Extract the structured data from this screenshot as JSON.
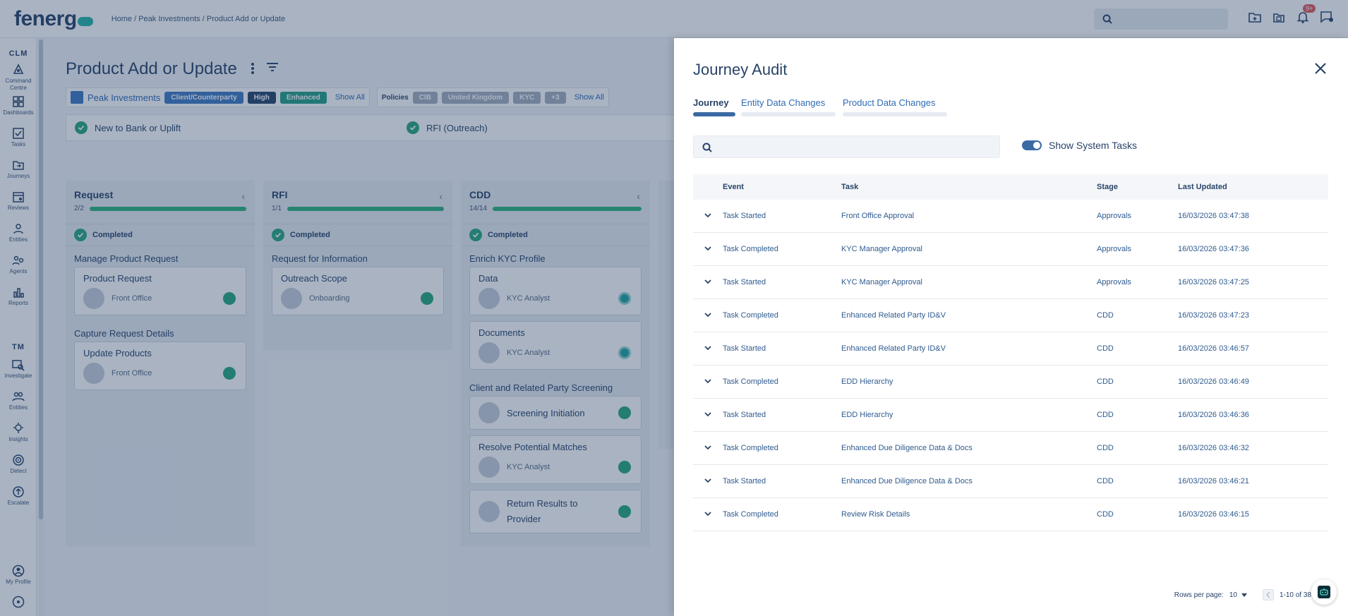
{
  "header": {
    "logo_text": "fenerg",
    "breadcrumb": "Home / Peak Investments / Product Add or Update",
    "notification_count": "9+"
  },
  "sidebar": {
    "section_clm": "CLM",
    "section_tm": "TM",
    "items_clm": [
      {
        "label": "Command Centre",
        "icon": "command-centre-icon"
      },
      {
        "label": "Dashboards",
        "icon": "dashboard-icon"
      },
      {
        "label": "Tasks",
        "icon": "tasks-icon"
      },
      {
        "label": "Journeys",
        "icon": "journeys-icon"
      },
      {
        "label": "Reviews",
        "icon": "reviews-icon"
      },
      {
        "label": "Entities",
        "icon": "entities-icon"
      },
      {
        "label": "Agents",
        "icon": "agents-icon"
      },
      {
        "label": "Reports",
        "icon": "reports-icon"
      }
    ],
    "items_tm": [
      {
        "label": "Investigate",
        "icon": "investigate-icon"
      },
      {
        "label": "Entities",
        "icon": "entities-icon"
      },
      {
        "label": "Insights",
        "icon": "insights-icon"
      },
      {
        "label": "Detect",
        "icon": "detect-icon"
      },
      {
        "label": "Escalate",
        "icon": "escalate-icon"
      }
    ],
    "profile_label": "My Profile"
  },
  "page": {
    "title": "Product Add or Update",
    "entity_name": "Peak Investments",
    "entity_chips": [
      "Client/Counterparty",
      "High",
      "Enhanced"
    ],
    "show_all": "Show All",
    "policies_label": "Policies",
    "policy_chips": [
      "CIB",
      "United Kingdom",
      "KYC",
      "+3"
    ],
    "stages": [
      "New to Bank or Uplift",
      "RFI (Outreach)"
    ]
  },
  "board": {
    "columns": [
      {
        "title": "Request",
        "progress_text": "2/2",
        "progress": 1.0,
        "completed_label": "Completed",
        "groups": [
          {
            "title": "Manage Product Request",
            "tasks": [
              {
                "name": "Product Request",
                "role": "Front Office"
              }
            ]
          },
          {
            "title": "Capture Request Details",
            "tasks": [
              {
                "name": "Update Products",
                "role": "Front Office"
              }
            ]
          }
        ]
      },
      {
        "title": "RFI",
        "progress_text": "1/1",
        "progress": 1.0,
        "completed_label": "Completed",
        "groups": [
          {
            "title": "Request for Information",
            "tasks": [
              {
                "name": "Outreach Scope",
                "role": "Onboarding"
              }
            ]
          }
        ]
      },
      {
        "title": "CDD",
        "progress_text": "14/14",
        "progress": 1.0,
        "completed_label": "Completed",
        "groups": [
          {
            "title": "Enrich KYC Profile",
            "tasks": [
              {
                "name": "Data",
                "role": "KYC Analyst"
              },
              {
                "name": "Documents",
                "role": "KYC Analyst"
              }
            ]
          },
          {
            "title": "Client and Related Party Screening",
            "tasks": [
              {
                "name": "Screening Initiation",
                "role": ""
              },
              {
                "name": "Resolve Potential Matches",
                "role": "KYC Analyst"
              },
              {
                "name": "Return Results to Provider",
                "role": ""
              }
            ]
          }
        ]
      }
    ]
  },
  "drawer": {
    "title": "Journey Audit",
    "tabs": [
      "Journey",
      "Entity Data Changes",
      "Product Data Changes"
    ],
    "search_placeholder": "",
    "toggle_label": "Show System Tasks",
    "toggle_on": true,
    "table": {
      "headers": [
        "Event",
        "Task",
        "Stage",
        "Last Updated"
      ],
      "rows": [
        [
          "Task Started",
          "Front Office Approval",
          "Approvals",
          "16/03/2026 03:47:38"
        ],
        [
          "Task Completed",
          "KYC Manager Approval",
          "Approvals",
          "16/03/2026 03:47:36"
        ],
        [
          "Task Started",
          "KYC Manager Approval",
          "Approvals",
          "16/03/2026 03:47:25"
        ],
        [
          "Task Completed",
          "Enhanced Related Party ID&V",
          "CDD",
          "16/03/2026 03:47:23"
        ],
        [
          "Task Started",
          "Enhanced Related Party ID&V",
          "CDD",
          "16/03/2026 03:46:57"
        ],
        [
          "Task Completed",
          "EDD Hierarchy",
          "CDD",
          "16/03/2026 03:46:49"
        ],
        [
          "Task Started",
          "EDD Hierarchy",
          "CDD",
          "16/03/2026 03:46:36"
        ],
        [
          "Task Completed",
          "Enhanced Due Diligence Data & Docs",
          "CDD",
          "16/03/2026 03:46:32"
        ],
        [
          "Task Started",
          "Enhanced Due Diligence Data & Docs",
          "CDD",
          "16/03/2026 03:46:21"
        ],
        [
          "Task Completed",
          "Review Risk Details",
          "CDD",
          "16/03/2026 03:46:15"
        ]
      ]
    },
    "pagination": {
      "rows_per_page_label": "Rows per page:",
      "rows_per_page": "10",
      "range": "1-10 of 38"
    }
  },
  "colors": {
    "primary": "#294469",
    "accent": "#3a6aa3",
    "success": "#29a97f",
    "teal": "#25b5a6"
  }
}
